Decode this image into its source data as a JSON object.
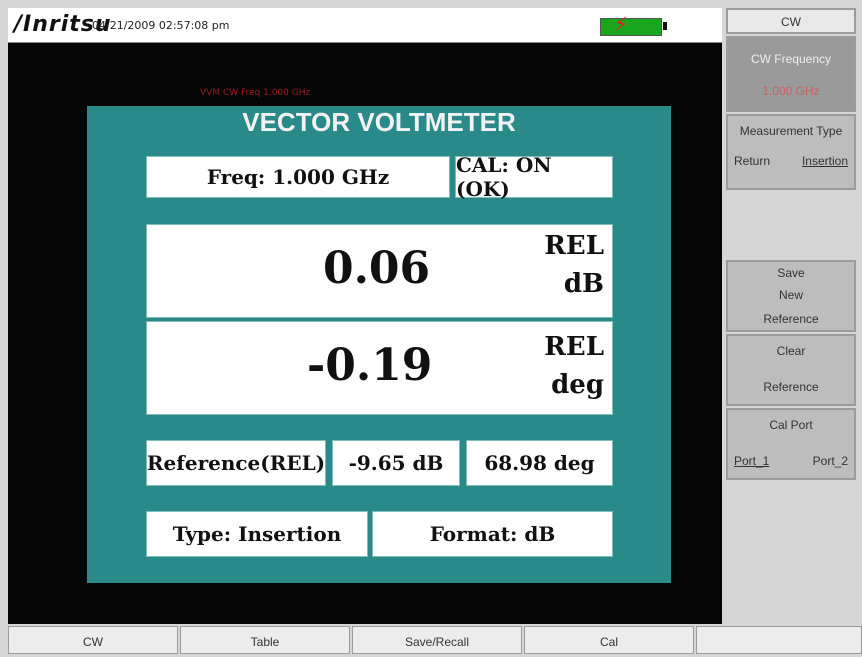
{
  "header": {
    "logo": "/Inritsu",
    "datetime": "04/21/2009 02:57:08 pm"
  },
  "faint_label": "VVM CW Freq 1.000 GHz",
  "panel": {
    "title": "VECTOR VOLTMETER",
    "freq": "Freq: 1.000 GHz",
    "cal": "CAL: ON (OK)",
    "magnitude": {
      "value": "0.06",
      "unit_line1": "REL",
      "unit_line2": "dB"
    },
    "phase": {
      "value": "-0.19",
      "unit_line1": "REL",
      "unit_line2": "deg"
    },
    "reference": {
      "label": "Reference(REL)",
      "db": "-9.65 dB",
      "deg": "68.98 deg"
    },
    "type": "Type: Insertion",
    "format": "Format: dB"
  },
  "softkeys": {
    "menu_title": "CW",
    "cw_frequency": {
      "label": "CW Frequency",
      "value": "1.000 GHz"
    },
    "measurement_type": {
      "label": "Measurement Type",
      "opt1": "Return",
      "opt2": "Insertion"
    },
    "save_ref": {
      "l1": "Save",
      "l2": "New",
      "l3": "Reference"
    },
    "clear_ref": {
      "l1": "Clear",
      "l2": "Reference"
    },
    "cal_port": {
      "label": "Cal Port",
      "opt1": "Port_1",
      "opt2": "Port_2"
    }
  },
  "bottom_menu": [
    "CW",
    "Table",
    "Save/Recall",
    "Cal",
    ""
  ],
  "colors": {
    "panel": "#2a8a8a",
    "battery": "#1aa51f",
    "accent_red": "#e02020"
  }
}
